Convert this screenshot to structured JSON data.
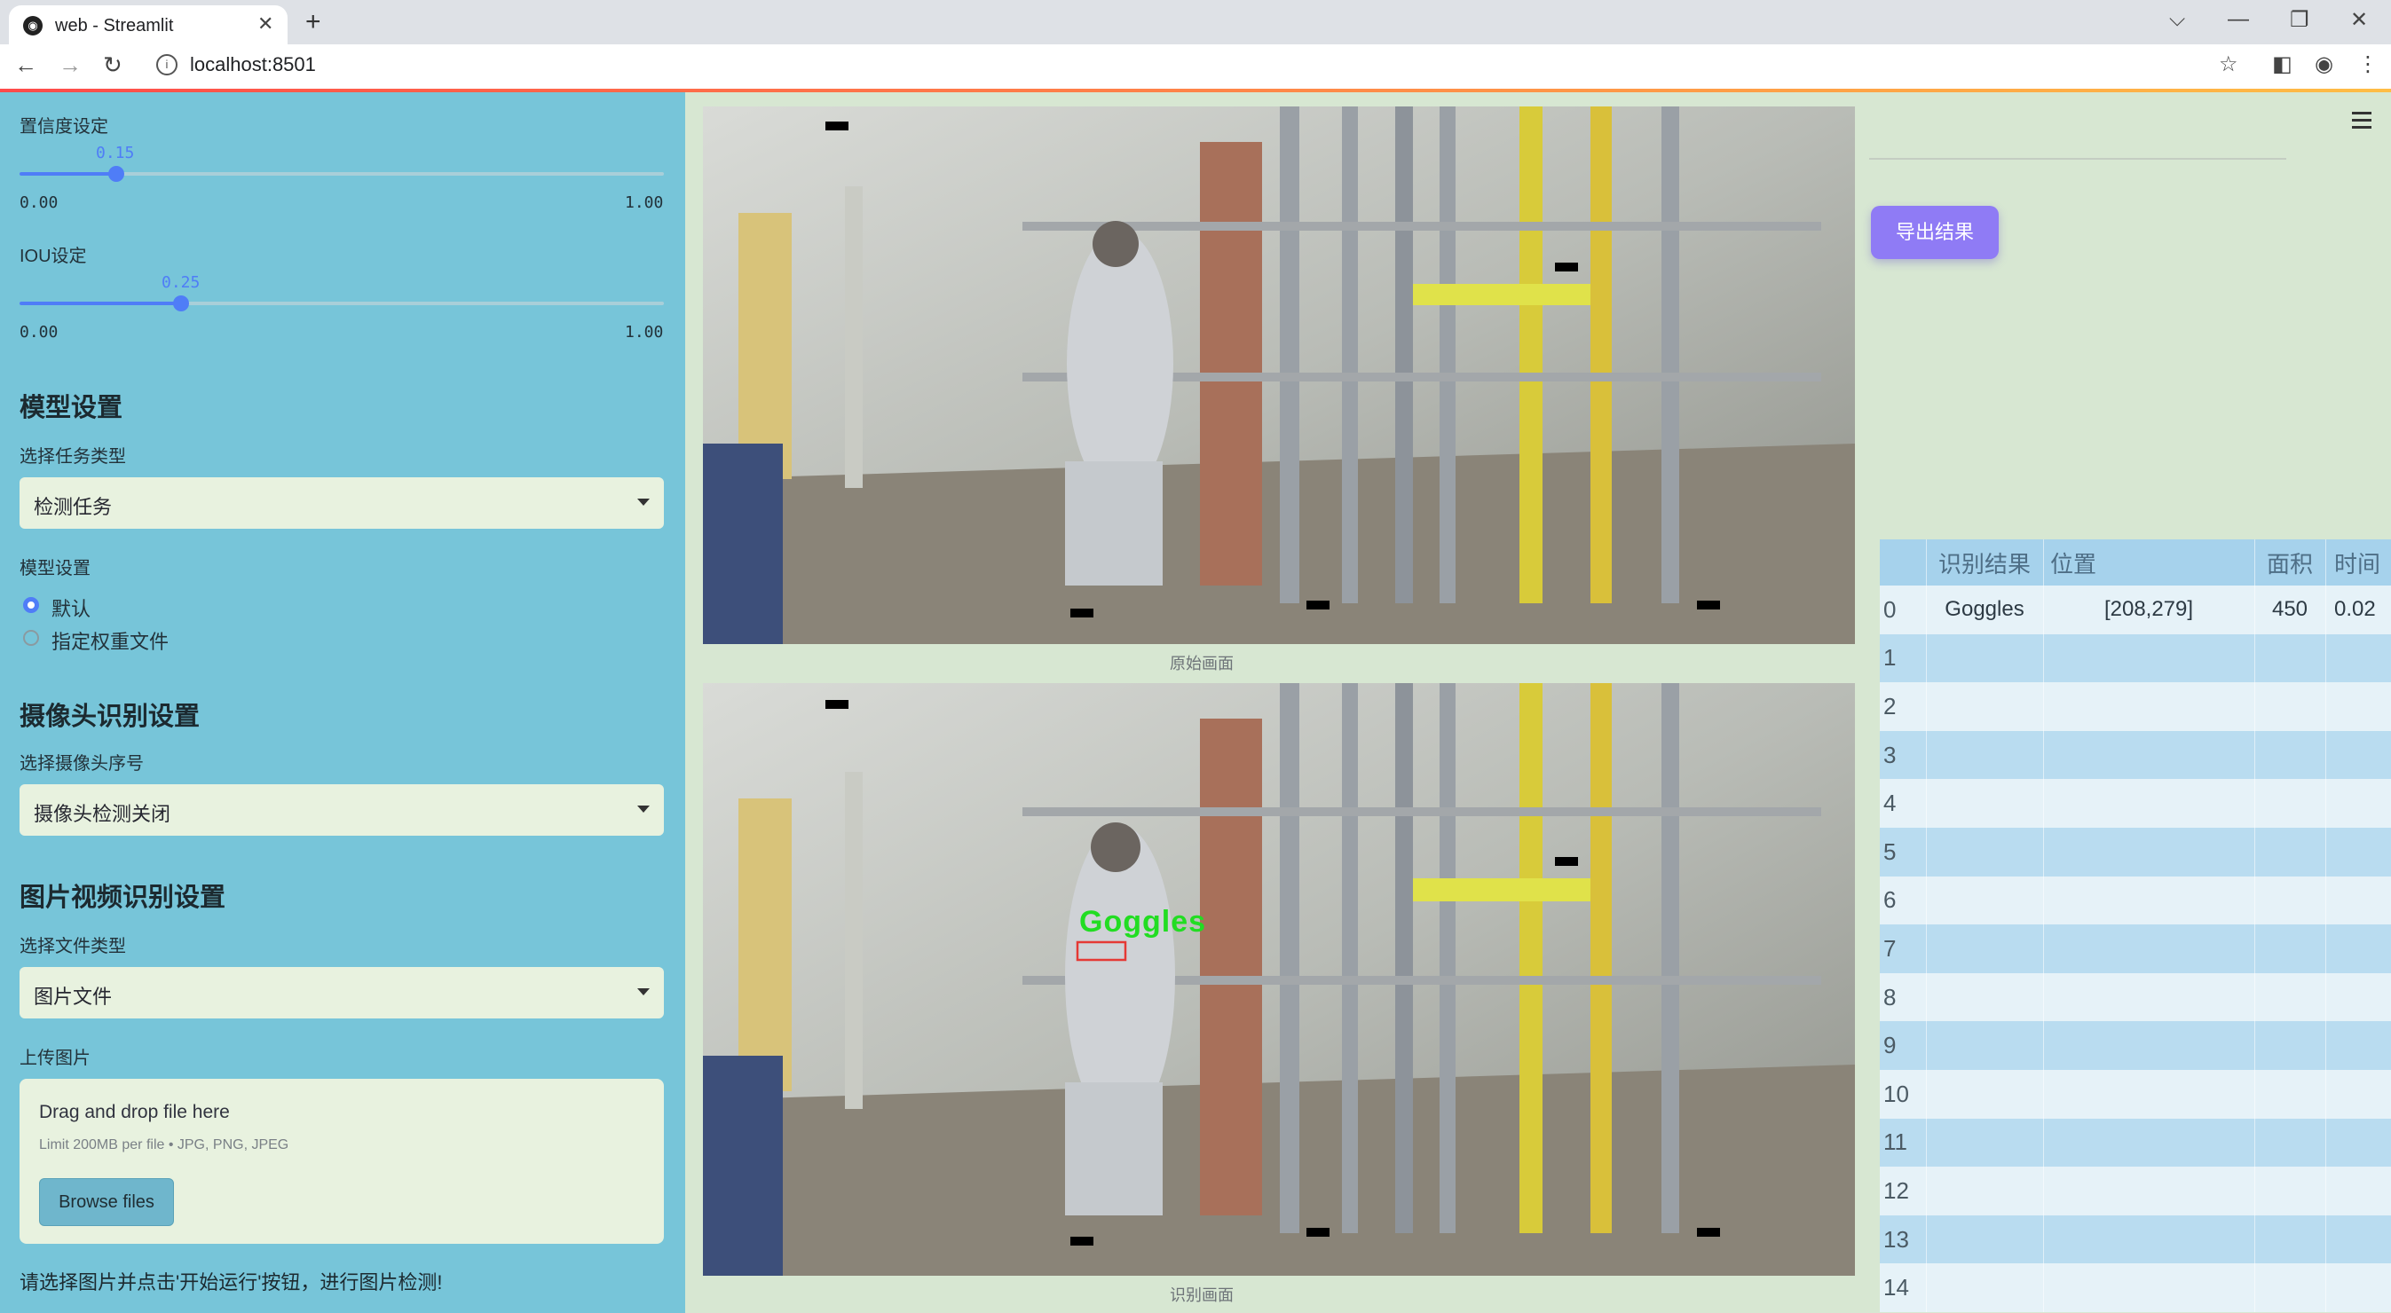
{
  "browser": {
    "tab_title": "web - Streamlit",
    "url": "localhost:8501"
  },
  "sidebar": {
    "confidence": {
      "label": "置信度设定",
      "value_text": "0.15",
      "value": 0.15,
      "min": "0.00",
      "max": "1.00"
    },
    "iou": {
      "label": "IOU设定",
      "value_text": "0.25",
      "value": 0.25,
      "min": "0.00",
      "max": "1.00"
    },
    "model_section": {
      "heading": "模型设置",
      "task_label": "选择任务类型",
      "task_value": "检测任务",
      "model_label": "模型设置",
      "options": [
        "默认",
        "指定权重文件"
      ],
      "selected_index": 0
    },
    "camera_section": {
      "heading": "摄像头识别设置",
      "camera_label": "选择摄像头序号",
      "camera_value": "摄像头检测关闭"
    },
    "file_section": {
      "heading": "图片视频识别设置",
      "filetype_label": "选择文件类型",
      "filetype_value": "图片文件",
      "upload_label": "上传图片",
      "drop_text": "Drag and drop file here",
      "limit_text": "Limit 200MB per file • JPG, PNG, JPEG",
      "browse_label": "Browse files"
    },
    "hint": "请选择图片并点击'开始运行'按钮，进行图片检测!"
  },
  "main": {
    "original_caption": "原始画面",
    "result_caption": "识别画面",
    "detection_label": "Goggles",
    "export_button": "导出结果"
  },
  "results_table": {
    "headers": [
      "识别结果",
      "位置",
      "面积",
      "时间"
    ],
    "rows": [
      {
        "idx": "0",
        "result": "Goggles",
        "position": "[208,279]",
        "area": "450",
        "time": "0.02"
      },
      {
        "idx": "1"
      },
      {
        "idx": "2"
      },
      {
        "idx": "3"
      },
      {
        "idx": "4"
      },
      {
        "idx": "5"
      },
      {
        "idx": "6"
      },
      {
        "idx": "7"
      },
      {
        "idx": "8"
      },
      {
        "idx": "9"
      },
      {
        "idx": "10"
      },
      {
        "idx": "11"
      },
      {
        "idx": "12"
      },
      {
        "idx": "13"
      },
      {
        "idx": "14"
      }
    ]
  },
  "colors": {
    "sidebar": "#77c5d9",
    "main_bg": "#d7e7d2",
    "accent": "#4f7df7",
    "export": "#8f7bf5"
  }
}
